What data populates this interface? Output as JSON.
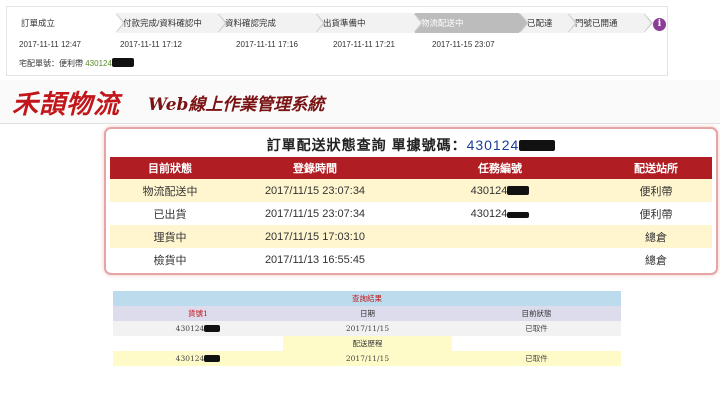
{
  "tracker": {
    "steps": [
      {
        "label": "訂單成立",
        "date": "2017-11-11 12:47"
      },
      {
        "label": "付款完成/資料確認中",
        "date": "2017-11-11 17:12"
      },
      {
        "label": "資料確認完成",
        "date": "2017-11-11 17:16"
      },
      {
        "label": "出貨準備中",
        "date": "2017-11-11 17:21"
      },
      {
        "label": "物流配送中",
        "date": "2017-11-15 23:07"
      },
      {
        "label": "已配達",
        "date": ""
      },
      {
        "label": "門號已開通",
        "date": ""
      }
    ],
    "active_step": "物流配送中",
    "info_icon": "i",
    "carrier_label": "宅配單號：便利帶",
    "carrier_number": "430124"
  },
  "header": {
    "logo": "禾頡物流",
    "system_title": "Web線上作業管理系統"
  },
  "panel": {
    "title_prefix": "訂單配送狀態查詢  單據號碼：",
    "order_number": "430124",
    "columns": [
      "目前狀態",
      "登錄時間",
      "任務編號",
      "配送站所"
    ],
    "rows": [
      {
        "status": "物流配送中",
        "time": "2017/11/15 23:07:34",
        "task": "430124",
        "station": "便利帶"
      },
      {
        "status": "已出貨",
        "time": "2017/11/15 23:07:34",
        "task": "430124",
        "station": "便利帶"
      },
      {
        "status": "理貨中",
        "time": "2017/11/15 17:03:10",
        "task": "",
        "station": "總倉"
      },
      {
        "status": "檢貨中",
        "time": "2017/11/13 16:55:45",
        "task": "",
        "station": "總倉"
      }
    ]
  },
  "result": {
    "title": "查詢結果",
    "columns": [
      "貨號1",
      "日期",
      "目前狀態"
    ],
    "row": {
      "code": "430124",
      "date": "2017/11/15",
      "status": "已取件"
    },
    "history_title": "配送歷程",
    "history": {
      "code": "430124",
      "date": "2017/11/15",
      "status": "已取件"
    }
  },
  "colors": {
    "brand_red": "#c2161b",
    "header_row": "#b01e24",
    "active_step": "#bcbcbc",
    "info_dot": "#8a3e95"
  }
}
